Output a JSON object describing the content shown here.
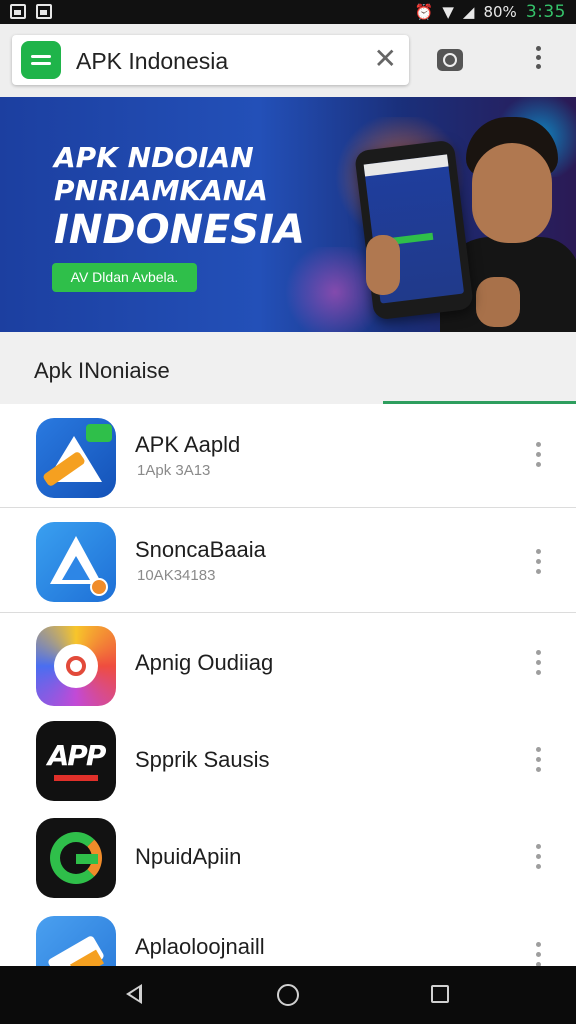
{
  "status_bar": {
    "battery": "80%",
    "clock": "3:35"
  },
  "search": {
    "query": "APK Indonesia",
    "icons": [
      "app-logo-icon",
      "close-icon",
      "camera-icon",
      "more-vert-icon"
    ]
  },
  "banner": {
    "line1": "APK NDOIAN",
    "line2": "PNRIAMKANA",
    "line3": "INDONESIA",
    "button_label": "AV Dldan Avbela."
  },
  "section": {
    "title": "Apk INoniaise"
  },
  "apps": [
    {
      "name": "APK Aapld",
      "subtitle": "1Apk 3A13",
      "icon": "apk-arrow-icon"
    },
    {
      "name": "SnoncaBaaia",
      "subtitle": "10AK34183",
      "icon": "a-triangle-icon"
    },
    {
      "name": "Apnig Oudiiag",
      "subtitle": "",
      "icon": "circle-gradient-icon"
    },
    {
      "name": "Spprik Sausis",
      "subtitle": "",
      "icon": "app-text-icon"
    },
    {
      "name": "NpuidApiin",
      "subtitle": "",
      "icon": "g-logo-icon"
    },
    {
      "name": "Aplaoloojnaill",
      "subtitle": "",
      "icon": "arrow-tilt-icon"
    }
  ],
  "colors": {
    "accent_green": "#2fbf4a",
    "tab_underline": "#2e9e5e",
    "banner_blue": "#1c3fa0"
  }
}
